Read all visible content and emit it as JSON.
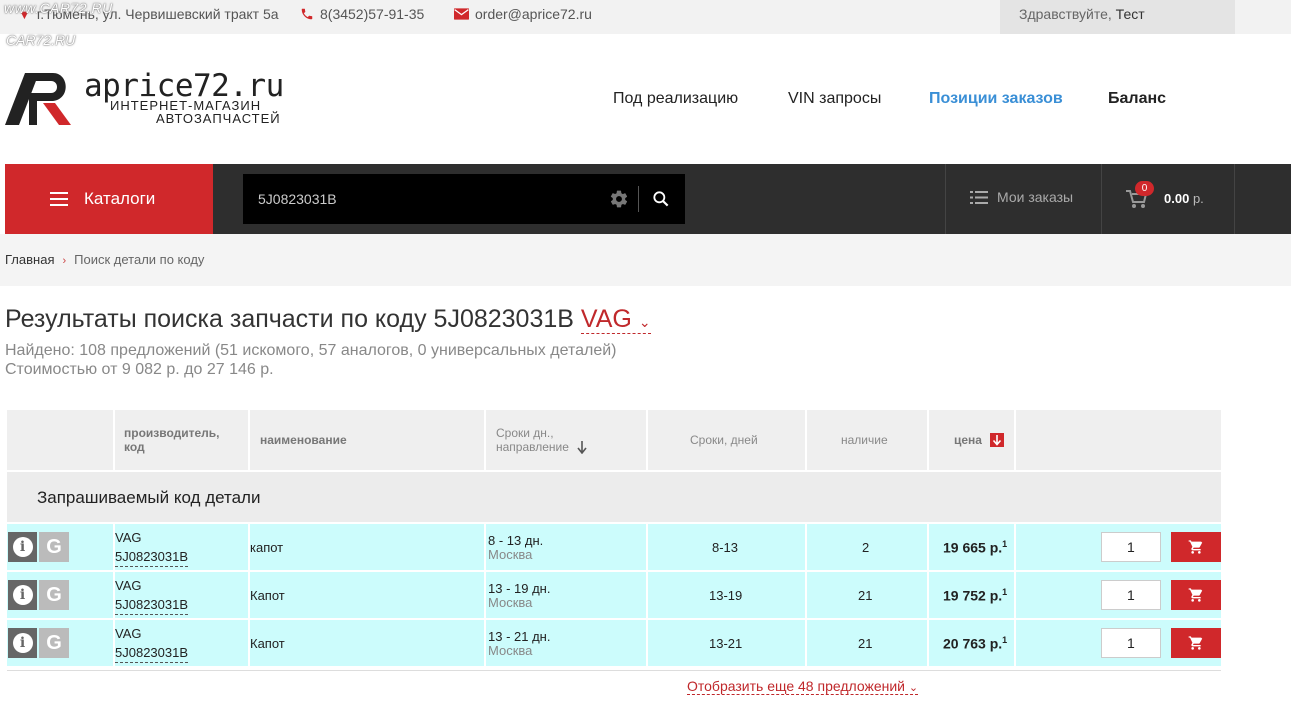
{
  "topbar": {
    "watermark": "www.CAR72.RU",
    "watermark2": "CAR72.RU",
    "address": "г.Тюмень, ул. Червишевский тракт 5а",
    "phone": "8(3452)57-91-35",
    "email": "order@aprice72.ru",
    "greeting": "Здравствуйте,",
    "user": "Тест"
  },
  "header": {
    "logo_title": "aprice72.ru",
    "logo_sub1": "ИНТЕРНЕТ-МАГАЗИН",
    "logo_sub2": "АВТОЗАПЧАСТЕЙ",
    "nav": [
      {
        "label": "Под реализацию"
      },
      {
        "label": "VIN запросы"
      },
      {
        "label": "Позиции заказов"
      },
      {
        "label": "Баланс"
      }
    ]
  },
  "toolbar": {
    "catalog_label": "Каталоги",
    "search_value": "5J0823031B",
    "orders_label": "Мои заказы",
    "cart_count": "0",
    "cart_total": "0.00",
    "cart_currency": "р."
  },
  "breadcrumb": {
    "home": "Главная",
    "current": "Поиск детали по коду"
  },
  "results": {
    "title_prefix": "Результаты поиска запчасти по коду 5J0823031B",
    "brand": "VAG",
    "found": "Найдено: 108 предложений (51 искомого, 57 аналогов, 0 универсальных деталей)",
    "price_range": "Стоимостью от 9 082 р. до 27 146 р."
  },
  "table": {
    "headers": {
      "maker_line1": "производитель,",
      "maker_line2": "код",
      "name": "наименование",
      "terms_line1": "Сроки дн.,",
      "terms_line2": "направление",
      "days": "Сроки, дней",
      "stock": "наличие",
      "price": "цена"
    },
    "section_title": "Запрашиваемый код детали",
    "rows": [
      {
        "brand": "VAG",
        "code": "5J0823031B",
        "name": "капот",
        "term": "8 - 13 дн.",
        "city": "Москва",
        "days": "8-13",
        "stock": "2",
        "price": "19 665 р.",
        "sup": "1",
        "qty": "1"
      },
      {
        "brand": "VAG",
        "code": "5J0823031B",
        "name": "Капот",
        "term": "13 - 19 дн.",
        "city": "Москва",
        "days": "13-19",
        "stock": "21",
        "price": "19 752 р.",
        "sup": "1",
        "qty": "1"
      },
      {
        "brand": "VAG",
        "code": "5J0823031B",
        "name": "Капот",
        "term": "13 - 21 дн.",
        "city": "Москва",
        "days": "13-21",
        "stock": "21",
        "price": "20 763 р.",
        "sup": "1",
        "qty": "1"
      }
    ],
    "more_label": "Отобразить еще 48 предложений"
  },
  "colors": {
    "accent_red": "#d0282b",
    "row_bg": "#ccfcfc",
    "nav_active": "#3a8fd6",
    "dark_bar": "#2e2e2e"
  }
}
